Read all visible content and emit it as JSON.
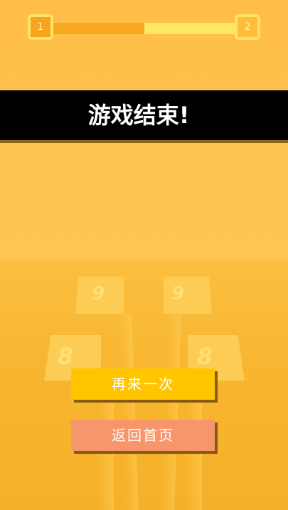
{
  "progress": {
    "current_level": "1",
    "next_level": "2",
    "fill_fraction": 0.5
  },
  "banner": {
    "title": "游戏结束!"
  },
  "tiles": [
    {
      "label": "9"
    },
    {
      "label": "9"
    },
    {
      "label": "8"
    },
    {
      "label": "8"
    }
  ],
  "buttons": {
    "again": "再来一次",
    "home": "返回首页"
  },
  "colors": {
    "background": "#ffc04a",
    "banner": "#000000",
    "again_button": "#ffc600",
    "home_button": "#f6966a",
    "progress_fill": "#f7a81f",
    "progress_track": "#ffe766"
  }
}
